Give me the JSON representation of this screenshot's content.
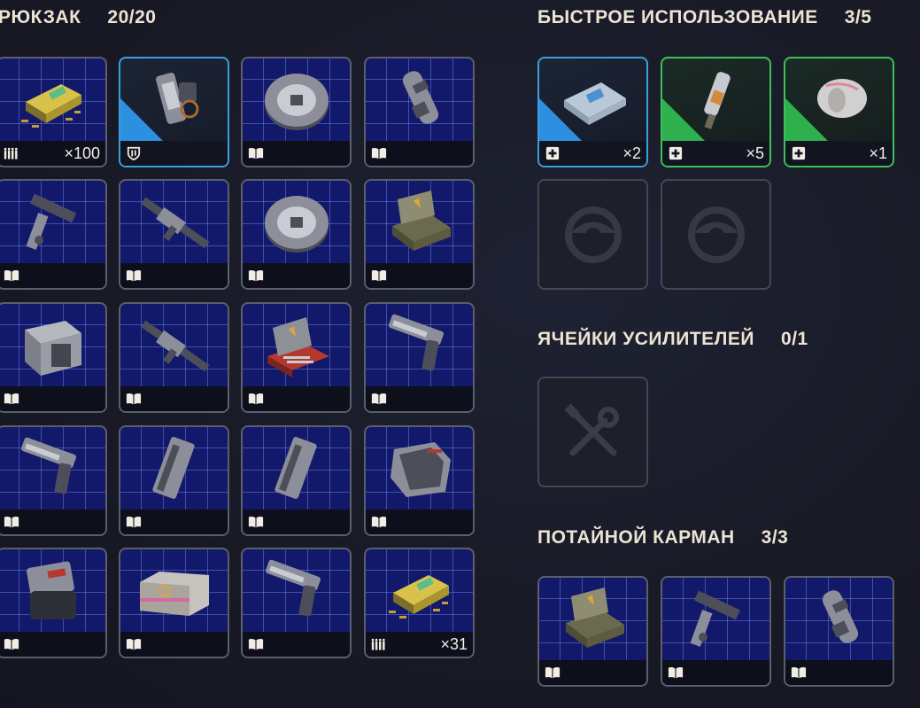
{
  "backpack": {
    "title": "РЮКЗАК",
    "count": "20/20",
    "items": [
      {
        "name": "ammo-box",
        "art": "ammo",
        "badge": "ammo-icon",
        "qty": "×100"
      },
      {
        "name": "gadget",
        "art": "gadget",
        "badge": "shield-icon",
        "qty": "",
        "rarity": "blue"
      },
      {
        "name": "disc-mine",
        "art": "disc",
        "badge": "book-icon",
        "qty": ""
      },
      {
        "name": "suppressor",
        "art": "canister",
        "badge": "book-icon",
        "qty": ""
      },
      {
        "name": "stock-part",
        "art": "stock",
        "badge": "book-icon",
        "qty": ""
      },
      {
        "name": "rifle",
        "art": "rifle",
        "badge": "book-icon",
        "qty": ""
      },
      {
        "name": "disc-mine-2",
        "art": "disc",
        "badge": "book-icon",
        "qty": ""
      },
      {
        "name": "weapon-case",
        "art": "case-open",
        "badge": "book-icon",
        "qty": ""
      },
      {
        "name": "ammo-can",
        "art": "crate",
        "badge": "book-icon",
        "qty": ""
      },
      {
        "name": "sniper-rifle",
        "art": "rifle",
        "badge": "book-icon",
        "qty": ""
      },
      {
        "name": "tool-case",
        "art": "case-red",
        "badge": "book-icon",
        "qty": ""
      },
      {
        "name": "pistol",
        "art": "pistol",
        "badge": "book-icon",
        "qty": ""
      },
      {
        "name": "pistol-2",
        "art": "pistol",
        "badge": "book-icon",
        "qty": ""
      },
      {
        "name": "magazine",
        "art": "mag",
        "badge": "book-icon",
        "qty": ""
      },
      {
        "name": "magazine-2",
        "art": "mag",
        "badge": "book-icon",
        "qty": ""
      },
      {
        "name": "armor-plate",
        "art": "plate",
        "badge": "book-icon",
        "qty": ""
      },
      {
        "name": "backpack-frame",
        "art": "pack",
        "badge": "book-icon",
        "qty": ""
      },
      {
        "name": "supply-crate",
        "art": "container",
        "badge": "book-icon",
        "qty": ""
      },
      {
        "name": "revolver",
        "art": "pistol",
        "badge": "book-icon",
        "qty": ""
      },
      {
        "name": "ammo-box-2",
        "art": "ammo",
        "badge": "ammo-icon",
        "qty": "×31"
      }
    ]
  },
  "quick_use": {
    "title": "БЫСТРОЕ ИСПОЛЬЗОВАНИЕ",
    "count": "3/5",
    "items": [
      {
        "name": "bandage",
        "art": "bandage",
        "badge": "medkit-icon",
        "qty": "×2",
        "rarity": "blue"
      },
      {
        "name": "injector",
        "art": "injector",
        "badge": "medkit-icon",
        "qty": "×5",
        "rarity": "green"
      },
      {
        "name": "wrap",
        "art": "roll",
        "badge": "medkit-icon",
        "qty": "×1",
        "rarity": "green"
      }
    ],
    "empty_slots": 2
  },
  "augment_slots": {
    "title": "ЯЧЕЙКИ УСИЛИТЕЛЕЙ",
    "count": "0/1"
  },
  "safe_pocket": {
    "title": "ПОТАЙНОЙ КАРМАН",
    "count": "3/3",
    "items": [
      {
        "name": "pocket-case",
        "art": "case-open",
        "badge": "book-icon",
        "qty": ""
      },
      {
        "name": "pocket-stock",
        "art": "stock",
        "badge": "book-icon",
        "qty": ""
      },
      {
        "name": "pocket-part",
        "art": "canister",
        "badge": "book-icon",
        "qty": ""
      }
    ]
  },
  "colors": {
    "rarity_blue": "#2c8fe0",
    "rarity_green": "#2fb04e",
    "grid_bg": "#13196a"
  }
}
